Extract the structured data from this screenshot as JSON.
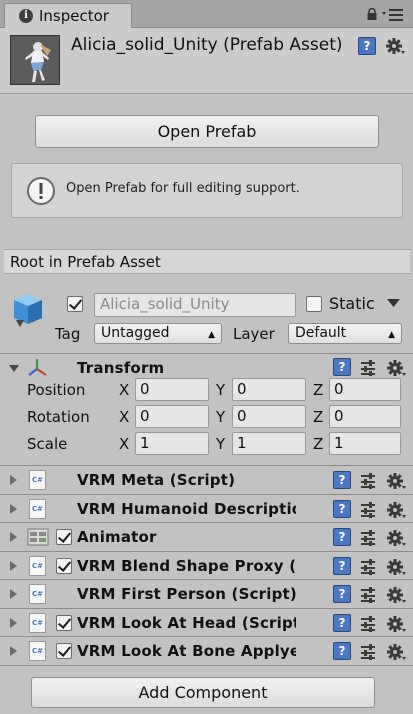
{
  "tab": {
    "title": "Inspector"
  },
  "header": {
    "object_name": "Alicia_solid_Unity (Prefab Asset)"
  },
  "prefab": {
    "open_button": "Open Prefab",
    "help_text": "Open Prefab for full editing support."
  },
  "root_label": "Root in Prefab Asset",
  "gameobject": {
    "active": true,
    "name": "Alicia_solid_Unity",
    "static_label": "Static",
    "static": false,
    "tag_label": "Tag",
    "tag_value": "Untagged",
    "layer_label": "Layer",
    "layer_value": "Default"
  },
  "transform": {
    "title": "Transform",
    "rows": [
      {
        "label": "Position",
        "x": "0",
        "y": "0",
        "z": "0"
      },
      {
        "label": "Rotation",
        "x": "0",
        "y": "0",
        "z": "0"
      },
      {
        "label": "Scale",
        "x": "1",
        "y": "1",
        "z": "1"
      }
    ],
    "axis": {
      "x": "X",
      "y": "Y",
      "z": "Z"
    }
  },
  "components": [
    {
      "title": "VRM Meta (Script)",
      "icon": "script-icon",
      "checkbox": false
    },
    {
      "title": "VRM Humanoid Description (Script)",
      "icon": "script-icon",
      "checkbox": false
    },
    {
      "title": "Animator",
      "icon": "animator-icon",
      "checkbox": true
    },
    {
      "title": "VRM Blend Shape Proxy (Script)",
      "icon": "script-icon",
      "checkbox": true
    },
    {
      "title": "VRM First Person (Script)",
      "icon": "script-icon",
      "checkbox": false
    },
    {
      "title": "VRM Look At Head (Script)",
      "icon": "script-icon",
      "checkbox": true
    },
    {
      "title": "VRM Look At Bone Applyer (Script)",
      "icon": "script-icon",
      "checkbox": true
    }
  ],
  "script_icon_text": "C#",
  "help_icon_text": "?",
  "add_component_button": "Add Component",
  "colors": {
    "help_blue": "#4a78c4",
    "panel": "#c2c2c2",
    "header": "#cbcbcb"
  }
}
